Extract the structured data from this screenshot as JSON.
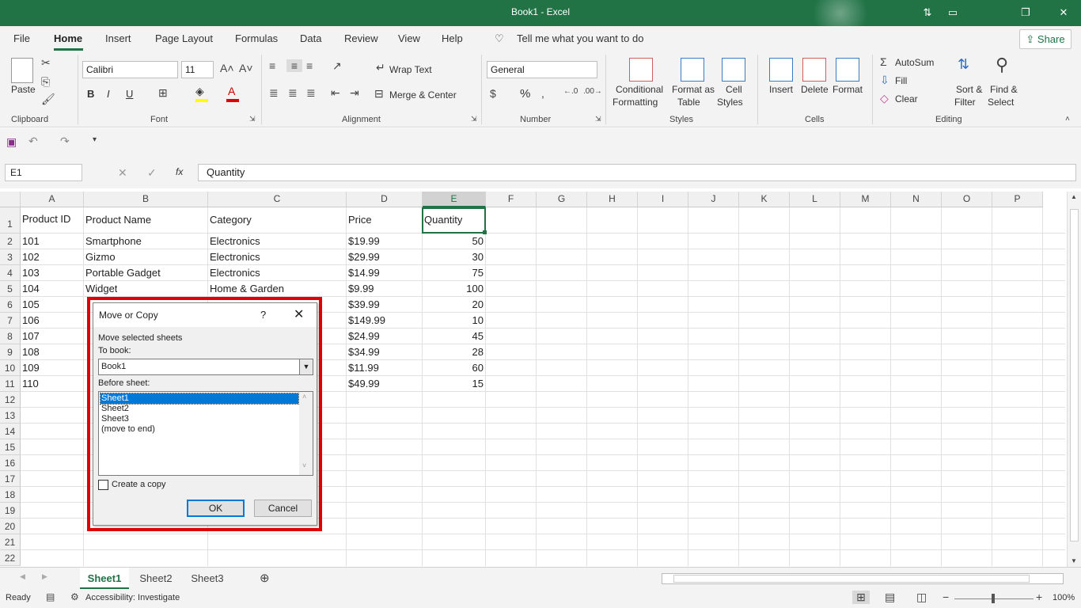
{
  "window": {
    "title": "Book1  -  Excel"
  },
  "menu": {
    "tabs": [
      "File",
      "Home",
      "Insert",
      "Page Layout",
      "Formulas",
      "Data",
      "Review",
      "View",
      "Help"
    ],
    "tell_me": "Tell me what you want to do",
    "share": "Share"
  },
  "ribbon": {
    "clipboard": {
      "paste": "Paste",
      "label": "Clipboard"
    },
    "font": {
      "name": "Calibri",
      "size": "11",
      "label": "Font",
      "bold": "B",
      "italic": "I",
      "underline": "U"
    },
    "alignment": {
      "wrap": "Wrap Text",
      "merge": "Merge & Center",
      "label": "Alignment"
    },
    "number": {
      "format": "General",
      "label": "Number",
      "percent": "%"
    },
    "styles": {
      "conditional": "Conditional",
      "formatting": "Formatting",
      "format_as": "Format as",
      "table": "Table",
      "cell": "Cell",
      "cell_styles": "Styles",
      "label": "Styles"
    },
    "cells": {
      "insert": "Insert",
      "delete": "Delete",
      "format": "Format",
      "label": "Cells"
    },
    "editing": {
      "autosum": "AutoSum",
      "fill": "Fill",
      "clear": "Clear",
      "sort": "Sort &",
      "filter": "Filter",
      "find": "Find &",
      "select": "Select",
      "label": "Editing"
    }
  },
  "formula_bar": {
    "name_box": "E1",
    "fx": "fx",
    "content": "Quantity"
  },
  "grid": {
    "columns": [
      "A",
      "B",
      "C",
      "D",
      "E",
      "F",
      "G",
      "H",
      "I",
      "J",
      "K",
      "L",
      "M",
      "N",
      "O",
      "P"
    ],
    "selected_column": "E",
    "row_numbers": [
      "1",
      "2",
      "3",
      "4",
      "5",
      "6",
      "7",
      "8",
      "9",
      "10",
      "11",
      "12",
      "13",
      "14",
      "15",
      "16",
      "17",
      "18",
      "19",
      "20",
      "21",
      "22"
    ],
    "headers": [
      "Product ID",
      "Product Name",
      "Category",
      "Price",
      "Quantity"
    ],
    "rows": [
      [
        "101",
        "Smartphone",
        "Electronics",
        "$19.99",
        "50"
      ],
      [
        "102",
        "Gizmo",
        "Electronics",
        "$29.99",
        "30"
      ],
      [
        "103",
        "Portable Gadget",
        "Electronics",
        "$14.99",
        "75"
      ],
      [
        "104",
        "Widget",
        "Home & Garden",
        "$9.99",
        "100"
      ],
      [
        "105",
        "",
        "",
        "$39.99",
        "20"
      ],
      [
        "106",
        "",
        "",
        "$149.99",
        "10"
      ],
      [
        "107",
        "",
        "",
        "$24.99",
        "45"
      ],
      [
        "108",
        "",
        "",
        "$34.99",
        "28"
      ],
      [
        "109",
        "",
        "",
        "$11.99",
        "60"
      ],
      [
        "110",
        "",
        "",
        "$49.99",
        "15"
      ]
    ]
  },
  "sheets": {
    "tabs": [
      "Sheet1",
      "Sheet2",
      "Sheet3"
    ],
    "active": "Sheet1"
  },
  "status": {
    "ready": "Ready",
    "accessibility": "Accessibility: Investigate",
    "zoom": "100%"
  },
  "dialog": {
    "title": "Move or Copy",
    "help": "?",
    "move_selected": "Move selected sheets",
    "to_book_label": "To book:",
    "to_book_value": "Book1",
    "before_sheet_label": "Before sheet:",
    "before_sheet_items": [
      "Sheet1",
      "Sheet2",
      "Sheet3",
      "(move to end)"
    ],
    "create_copy": "Create a copy",
    "ok": "OK",
    "cancel": "Cancel"
  }
}
